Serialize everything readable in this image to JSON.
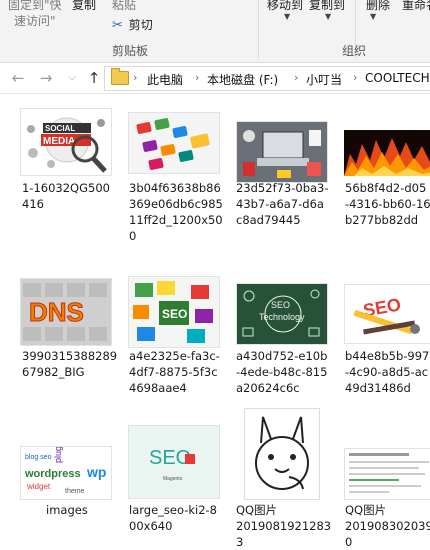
{
  "ribbon": {
    "pin_label_line1": "固定到\"快",
    "pin_label_line2": "速访问\"",
    "copy_label": "复制",
    "paste_label": "粘贴",
    "cut_label": "剪切",
    "clipboard_group": "剪贴板",
    "move_to_label": "移动到",
    "copy_to_label": "复制到",
    "delete_label": "删除",
    "rename_label": "重命名",
    "organize_group": "组织"
  },
  "address": {
    "crumbs": [
      "此电脑",
      "本地磁盘 (F:)",
      "小叮当",
      "COOLTECH"
    ]
  },
  "files": [
    {
      "name_lines": [
        "1-16032QG500",
        "416"
      ],
      "thumb": "social-media-image"
    },
    {
      "name_lines": [
        "3b04f63638b86",
        "369e06db6c985",
        "11ff2d_1200x50",
        "0"
      ],
      "thumb": "app-keys-image"
    },
    {
      "name_lines": [
        "23d52f73-0ba3-",
        "43b7-a6a7-d6a",
        "c8ad79445"
      ],
      "thumb": "laptop-desk-image"
    },
    {
      "name_lines": [
        "56b8f4d2-d05",
        "-4316-bb60-16",
        "b277bb82dd"
      ],
      "thumb": "fire-image"
    },
    {
      "name_lines": [
        "3990315388289",
        "67982_BIG"
      ],
      "thumb": "dns-image"
    },
    {
      "name_lines": [
        "a4e2325e-fa3c-",
        "4df7-8875-5f3c",
        "4698aae4"
      ],
      "thumb": "seo-puzzle-image"
    },
    {
      "name_lines": [
        "a430d752-e10b",
        "-4ede-b48c-815",
        "a20624c6c"
      ],
      "thumb": "seo-chalkboard-image"
    },
    {
      "name_lines": [
        "b44e8b5b-997",
        "-4c90-a8d5-ac",
        "49d31486d"
      ],
      "thumb": "seo-tools-image"
    },
    {
      "name_lines": [
        "images"
      ],
      "thumb": "word-cloud-image"
    },
    {
      "name_lines": [
        "large_seo-ki2-8",
        "00x640"
      ],
      "thumb": "seo-card-image"
    },
    {
      "name_lines": [
        "QQ图片",
        "2019081921283",
        "3"
      ],
      "thumb": "cartoon-image"
    },
    {
      "name_lines": [
        "QQ图片",
        "201908302039",
        "0"
      ],
      "thumb": "document-screenshot-image"
    }
  ]
}
